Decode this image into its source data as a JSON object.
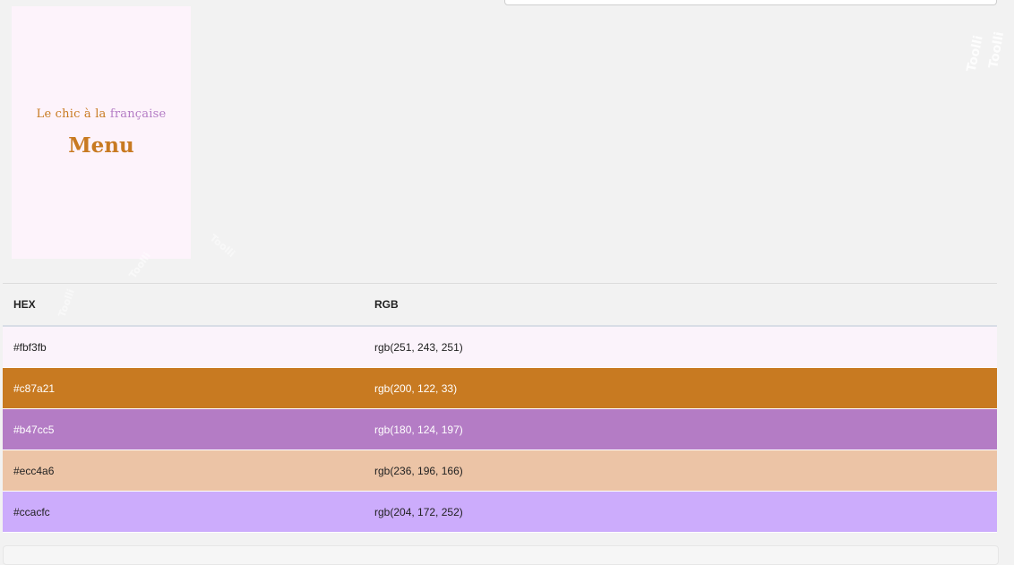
{
  "search": {
    "placeholder": ""
  },
  "preview": {
    "tagline_part1": "Le chic à la ",
    "tagline_part2": "française",
    "title": "Menu",
    "background": "#fdf3fb"
  },
  "watermark": {
    "text": "Toolli"
  },
  "table": {
    "headers": {
      "hex": "HEX",
      "rgb": "RGB"
    },
    "rows": [
      {
        "hex": "#fbf3fb",
        "rgb": "rgb(251, 243, 251)",
        "bg": "#fbf3fb",
        "fg": "#222222"
      },
      {
        "hex": "#c87a21",
        "rgb": "rgb(200, 122, 33)",
        "bg": "#c87a21",
        "fg": "#ffffff"
      },
      {
        "hex": "#b47cc5",
        "rgb": "rgb(180, 124, 197)",
        "bg": "#b47cc5",
        "fg": "#ffffff"
      },
      {
        "hex": "#ecc4a6",
        "rgb": "rgb(236, 196, 166)",
        "bg": "#ecc4a6",
        "fg": "#222222"
      },
      {
        "hex": "#ccacfc",
        "rgb": "rgb(204, 172, 252)",
        "bg": "#ccacfc",
        "fg": "#222222"
      }
    ]
  }
}
